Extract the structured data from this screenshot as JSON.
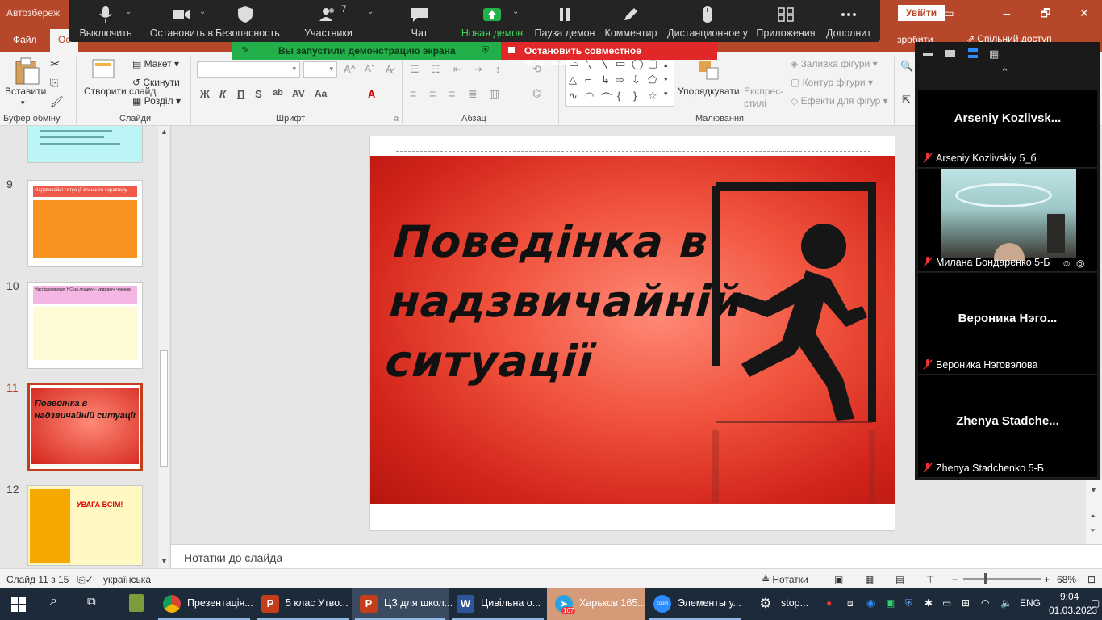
{
  "window": {
    "doc_title": "Автозбереж",
    "signin_label": "Увійти",
    "min": "🗕",
    "restore": "🗗",
    "close": "✕"
  },
  "tabs": {
    "items": [
      "Файл",
      "Ос"
    ],
    "tell_me": "зробити",
    "share": "Спільний доступ"
  },
  "ribbon": {
    "paste": "Вставити",
    "new_slide": "Створити слайд",
    "layout": "Макет",
    "reset": "Скинути",
    "section": "Розділ",
    "arrange": "Упорядкувати",
    "quick_styles": "Експрес-стилі",
    "shape_fill": "Заливка фігури",
    "shape_outline": "Контур фігури",
    "shape_effects": "Ефекти для фігур",
    "groups": {
      "clipboard": "Буфер обміну",
      "slides": "Слайди",
      "font": "Шрифт",
      "paragraph": "Абзац",
      "drawing": "Малювання"
    },
    "bold": "Ж",
    "italic": "К",
    "underline": "П",
    "strike": "S",
    "font_color": "А"
  },
  "zoom_toolbar": {
    "mute": "Выключить",
    "stop_video": "Остановить в",
    "security": "Безопасность",
    "participants": "Участники",
    "participants_count": "7",
    "chat": "Чат",
    "new_share": "Новая демон",
    "pause_share": "Пауза демон",
    "annotate": "Комментир",
    "remote": "Дистанционное у",
    "apps": "Приложения",
    "more": "Дополнит"
  },
  "share_banner": "Вы запустили демонстрацию экрана",
  "stop_share": "Остановить совместное использование",
  "thumbnails": [
    {
      "num": "9",
      "title": "Надзвичайні ситуації воєнного характеру"
    },
    {
      "num": "10",
      "title": "Наслідки впливу НС на людину – уражаючі чинники"
    },
    {
      "num": "11",
      "title": "Поведінка в надзвичайній ситуації"
    },
    {
      "num": "12",
      "title": "УВАГА ВСІМ!"
    }
  ],
  "slide": {
    "title_lines": [
      "Поведінка в",
      "надзвичайній",
      "ситуації"
    ]
  },
  "notes_placeholder": "Нотатки до слайда",
  "status": {
    "slide_counter": "Слайд 11 з 15",
    "language": "українська",
    "notes": "Нотатки",
    "zoom_level": "68%"
  },
  "participants": [
    {
      "display": "Arseniy  Kozlivsk...",
      "name": "Arseniy Kozlivskiy 5_б",
      "video": false
    },
    {
      "display": "",
      "name": "Милана Бондаренко 5-Б",
      "video": true
    },
    {
      "display": "Вероника  Нэго...",
      "name": "Вероника Нэговэлова",
      "video": false
    },
    {
      "display": "Zhenya  Stadche...",
      "name": "Zhenya Stadchenko 5-Б",
      "video": false
    }
  ],
  "taskbar": {
    "apps": [
      {
        "label": "Презентація...",
        "color": "#dd4b39"
      },
      {
        "label": "5 клас Утво...",
        "color": "#c43e1c"
      },
      {
        "label": "ЦЗ для школ...",
        "color": "#c43e1c"
      },
      {
        "label": "Цивільна о...",
        "color": "#2b579a"
      },
      {
        "label": "Харьков 165...",
        "color": "#2aa3e0"
      },
      {
        "label": "Элементы у...",
        "color": "#2d8cff"
      },
      {
        "label": "stop...",
        "color": "#555"
      }
    ],
    "telegram_badge": "167",
    "lang": "ENG",
    "time": "9:04",
    "date": "01.03.2023"
  },
  "colors": {
    "accent": "#b7472a",
    "zoom_green": "#23b04a",
    "zoom_red": "#e02828"
  }
}
